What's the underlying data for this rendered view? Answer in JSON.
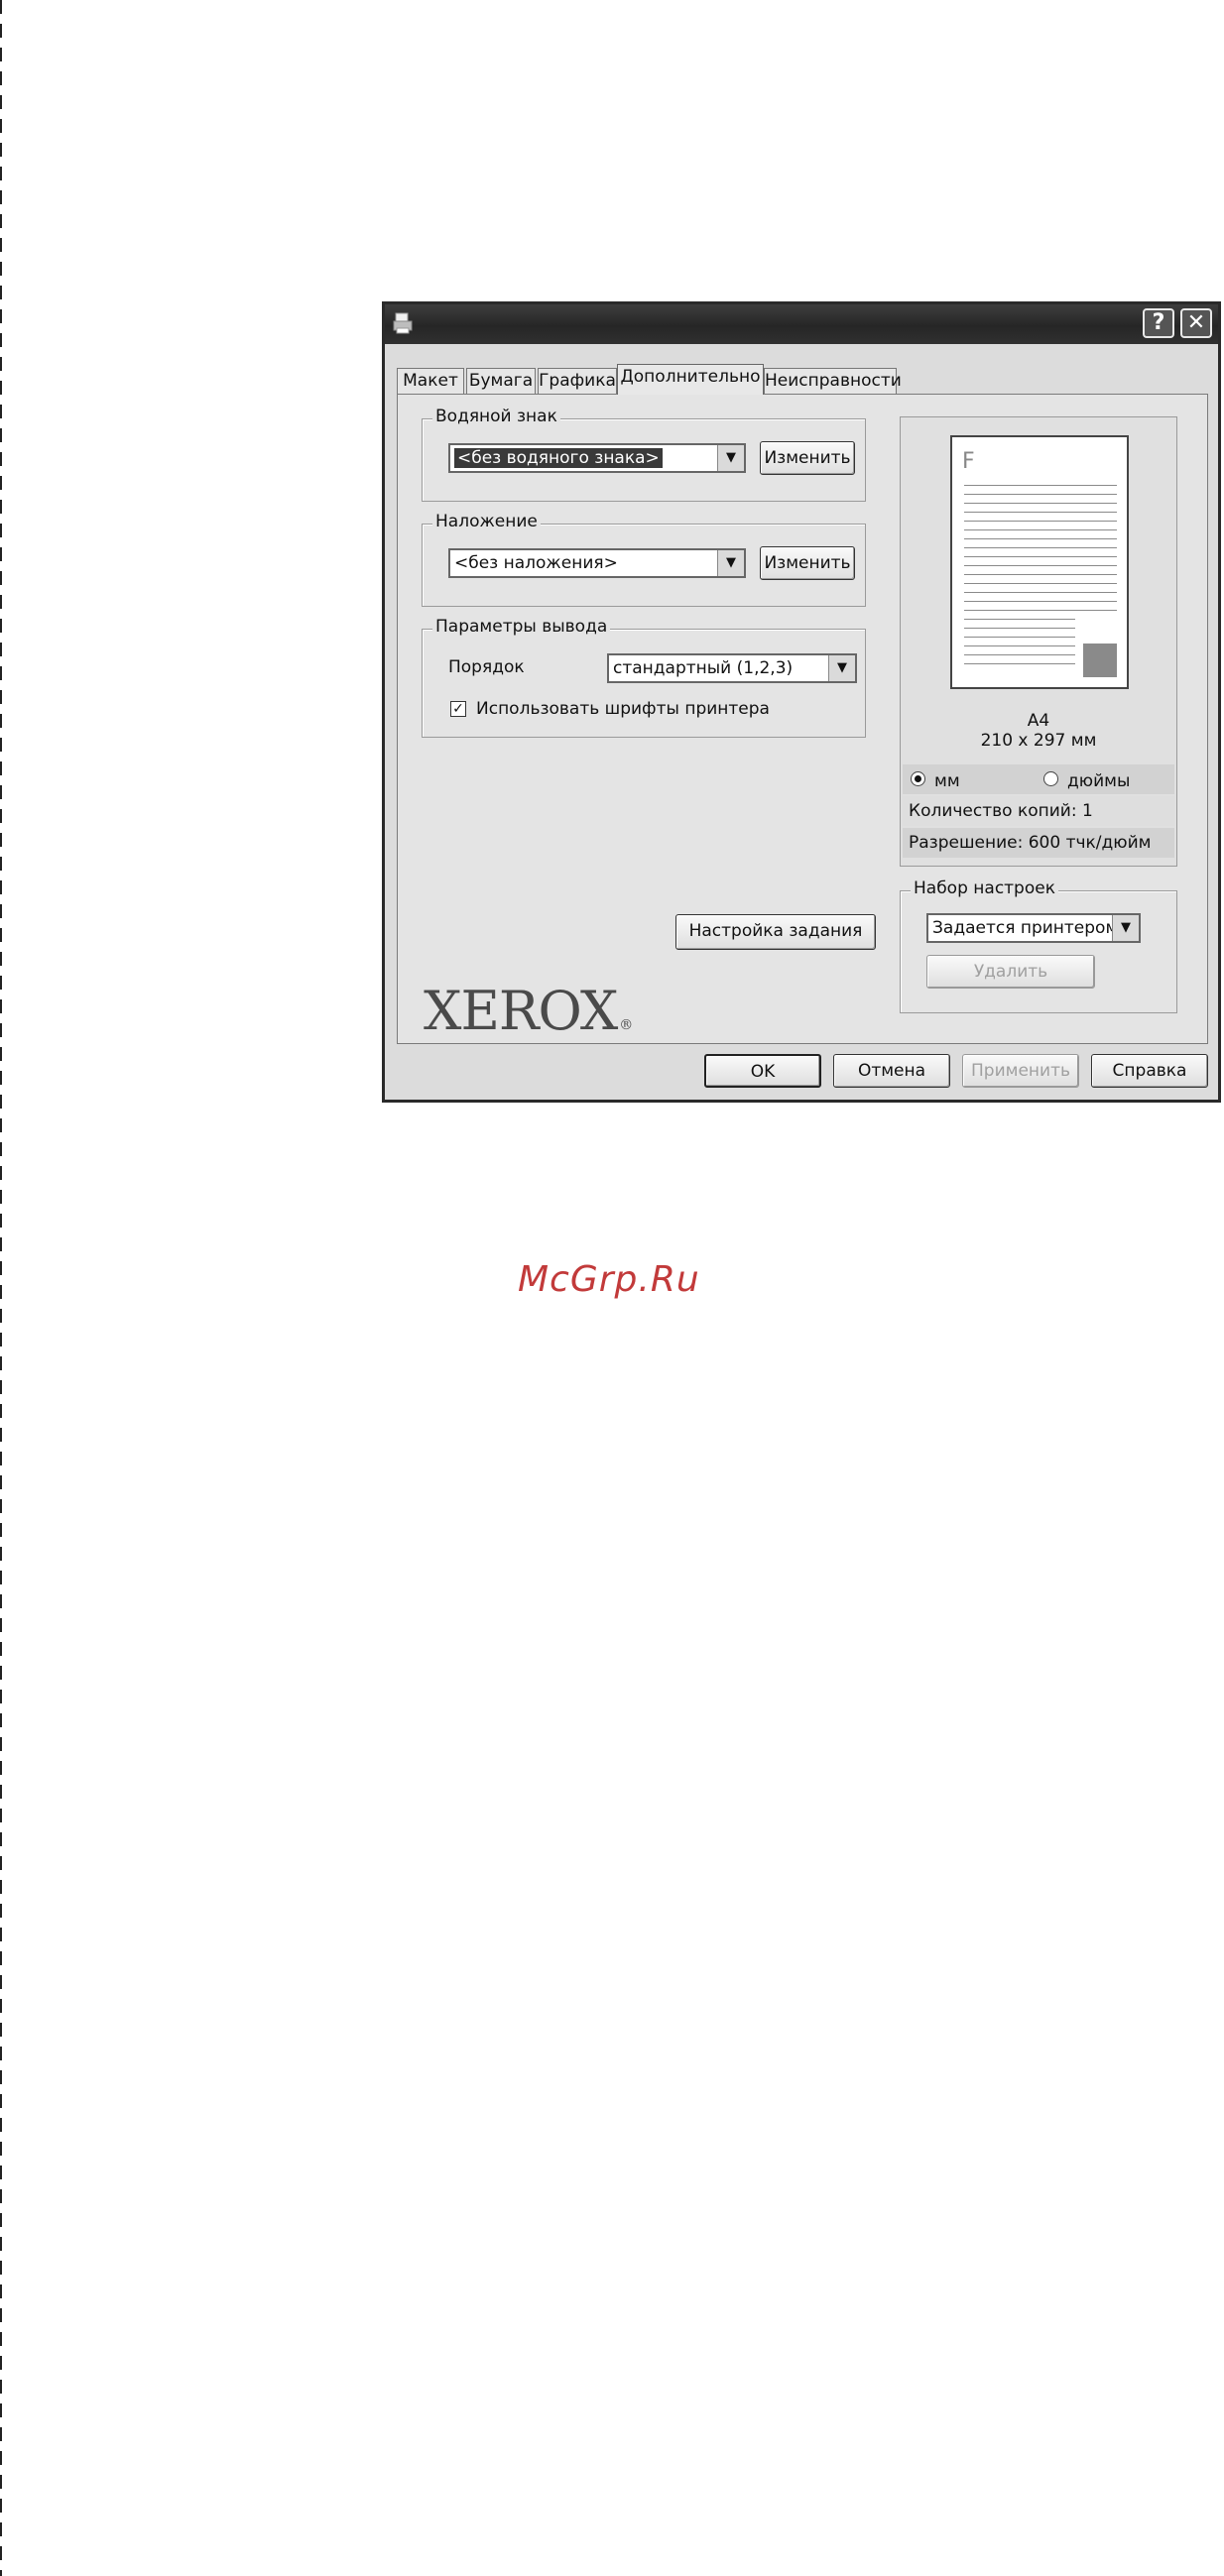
{
  "dialog": {
    "help_btn": "?",
    "close_btn": "✕",
    "printer_icon": "printer-icon"
  },
  "tabs": [
    {
      "label": "Макет"
    },
    {
      "label": "Бумага"
    },
    {
      "label": "Графика"
    },
    {
      "label": "Дополнительно",
      "active": true
    },
    {
      "label": "Неисправности"
    }
  ],
  "watermark_group": {
    "legend": "Водяной знак",
    "combo_value": "<без водяного знака>",
    "edit_btn": "Изменить"
  },
  "overlay_group": {
    "legend": "Наложение",
    "combo_value": "<без наложения>",
    "edit_btn": "Изменить"
  },
  "output_group": {
    "legend": "Параметры вывода",
    "order_label": "Порядок",
    "order_value": "стандартный (1,2,3)",
    "printer_fonts_label": "Использовать шрифты принтера",
    "printer_fonts_checked": true
  },
  "preview": {
    "paper_letter": "F",
    "paper_name": "A4",
    "paper_size": "210 x 297 мм",
    "unit_mm": "мм",
    "unit_inch": "дюймы",
    "unit_selected": "мм",
    "copies": "Количество копий: 1",
    "resolution": "Разрешение: 600 тчк/дюйм"
  },
  "job_setup_btn": "Настройка задания",
  "favorites": {
    "legend": "Набор настроек",
    "value": "Задается принтером",
    "delete_btn": "Удалить"
  },
  "brand": {
    "logo": "XEROX",
    "mark": "®"
  },
  "footer": {
    "ok": "OK",
    "cancel": "Отмена",
    "apply": "Применить",
    "help": "Справка"
  },
  "page_watermark": "McGrp.Ru"
}
